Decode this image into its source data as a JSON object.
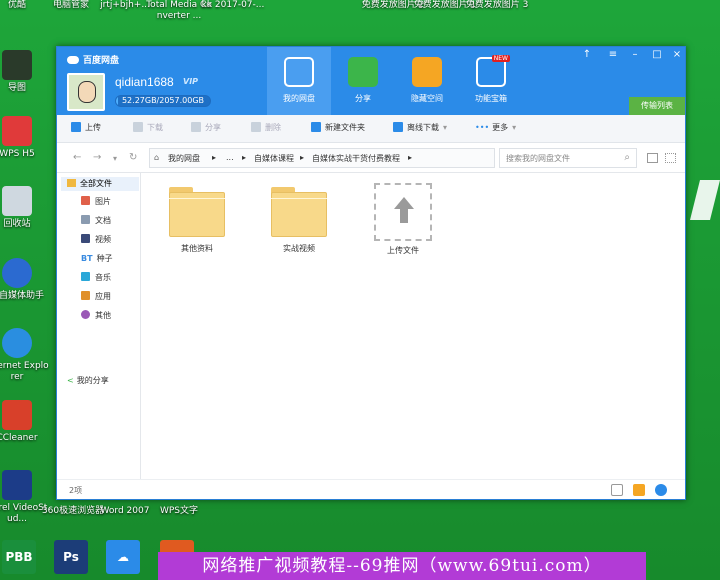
{
  "desktop": {
    "top_icons": [
      {
        "label": "优酷"
      },
      {
        "label": "电脑管家"
      },
      {
        "label": "jrtj+bjh+..."
      },
      {
        "label": "Total Media Converter ..."
      },
      {
        "label": "kk 2017-07-..."
      },
      {
        "label": "免费发放图片 2"
      },
      {
        "label": "免费发放图片 1"
      },
      {
        "label": "免费发放图片 3"
      }
    ],
    "left_icons": [
      {
        "label": "导图"
      },
      {
        "label": "WPS H5"
      },
      {
        "label": "回收站"
      },
      {
        "label": "媒自媒体助手"
      },
      {
        "label": "Internet Explorer"
      },
      {
        "label": "CCleaner"
      },
      {
        "label": "Corel VideoStud..."
      }
    ],
    "bottom_icons": [
      {
        "label": "360极速浏览器"
      },
      {
        "label": "Word 2007"
      },
      {
        "label": "WPS文字"
      }
    ],
    "taskbar_apps": [
      {
        "label": "PBB",
        "color": "#1a8f3c"
      },
      {
        "label": "Ps",
        "color": "#1c3d78"
      },
      {
        "label": "☁",
        "color": "#2b8be8"
      },
      {
        "label": "",
        "color": "#e05a20"
      }
    ],
    "banner": "网络推广视频教程--69推网（www.69tui.com）"
  },
  "window": {
    "app_title": "百度网盘",
    "username": "qidian1688",
    "vip_label": "VIP",
    "quota_text": "52.27GB/2057.00GB",
    "quota_fraction": 0.0254,
    "nav": [
      {
        "label": "我的网盘",
        "active": true,
        "color": "#ffffff"
      },
      {
        "label": "分享",
        "active": false,
        "color": "#3cb54a"
      },
      {
        "label": "隐藏空间",
        "active": false,
        "color": "#f5a623"
      },
      {
        "label": "功能宝箱",
        "active": false,
        "color": "#2b8be8"
      }
    ],
    "nav_new_badge": "NEW",
    "window_controls": [
      "↑",
      "≡",
      "–",
      "□",
      "×"
    ],
    "transfer_list": "传输列表",
    "toolbar": {
      "upload": "上传",
      "download": "下载",
      "share": "分享",
      "delete": "删除",
      "new_folder": "新建文件夹",
      "offline_download": "离线下载",
      "more": "更多"
    },
    "breadcrumb": [
      "我的网盘",
      "...",
      "自媒体课程",
      "自媒体实战干货付费教程"
    ],
    "search_placeholder": "搜索我的网盘文件",
    "sidebar": {
      "all_files": "全部文件",
      "items": [
        {
          "label": "图片",
          "color": "#e0604a"
        },
        {
          "label": "文档",
          "color": "#8a9bb0"
        },
        {
          "label": "视频",
          "color": "#3a4a78"
        },
        {
          "label": "种子",
          "color": "#3a8be0",
          "prefix": "BT"
        },
        {
          "label": "音乐",
          "color": "#2aa7d8"
        },
        {
          "label": "应用",
          "color": "#e0902a"
        },
        {
          "label": "其他",
          "color": "#9b59b6"
        }
      ],
      "my_share": "我的分享"
    },
    "files": [
      {
        "name": "其他资料",
        "type": "folder"
      },
      {
        "name": "实战视频",
        "type": "folder"
      },
      {
        "name": "上传文件",
        "type": "upload"
      }
    ],
    "status": {
      "count": "2项"
    }
  }
}
